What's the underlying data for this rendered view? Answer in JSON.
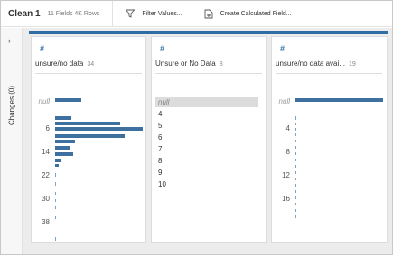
{
  "toolbar": {
    "title": "Clean 1",
    "meta": "11 Fields  4K Rows",
    "filter_label": "Filter Values...",
    "calc_label": "Create Calculated Field..."
  },
  "rail": {
    "label": "Changes (0)"
  },
  "cards": [
    {
      "type_icon": "#",
      "name": "unsure/no data",
      "count": "34",
      "axis": [
        "null",
        "6",
        "14",
        "22",
        "30",
        "38"
      ]
    },
    {
      "type_icon": "#",
      "name": "Unsure or No Data",
      "count": "8",
      "values": [
        "null",
        "4",
        "5",
        "6",
        "7",
        "8",
        "9",
        "10"
      ]
    },
    {
      "type_icon": "#",
      "name": "unsure/no data avai...",
      "count": "19",
      "axis": [
        "null",
        "4",
        "8",
        "12",
        "16"
      ]
    }
  ],
  "colors": {
    "accent": "#2f6ea5",
    "bar": "#3d6f9f"
  }
}
